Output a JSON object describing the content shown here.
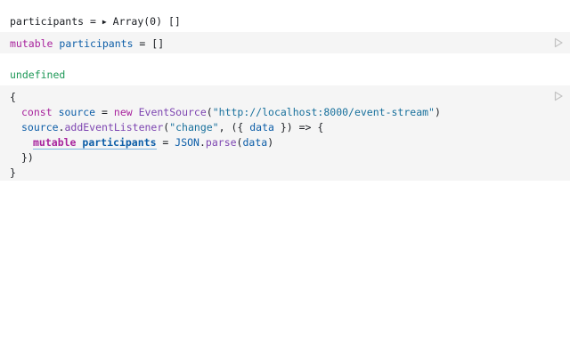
{
  "outputs": {
    "first": {
      "name": "participants",
      "eq": " = ",
      "toggle": "▶",
      "value": "Array(0)",
      "preview": " []"
    },
    "second": {
      "value": "undefined"
    }
  },
  "cell1": {
    "kw": "mutable",
    "name": "participants",
    "rest": " = []"
  },
  "cell2": {
    "l1": "{",
    "l2": {
      "kw_const": "const",
      "var_source": "source",
      "eq": " = ",
      "kw_new": "new",
      "cls": "EventSource",
      "open": "(",
      "url": "\"http://localhost:8000/event-stream\"",
      "close": ")"
    },
    "l3": {
      "obj": "source",
      "dot": ".",
      "method": "addEventListener",
      "open": "(",
      "event": "\"change\"",
      "mid": ", ({ ",
      "param": "data",
      "end": " }) => {"
    },
    "l4": {
      "kw": "mutable",
      "name": "participants",
      "eq": " = ",
      "json": "JSON",
      "dot": ".",
      "parse": "parse",
      "open": "(",
      "arg": "data",
      "close": ")"
    },
    "l5": "})",
    "l6": "}"
  },
  "colors": {
    "keyword": "#a8239d",
    "variable": "#0d5ea8",
    "string": "#18709c",
    "function": "#7d45b1",
    "undefined": "#1d9857",
    "cell_bg": "#f5f5f5",
    "run_icon": "#c4c4c4"
  },
  "icons": {
    "run": "play-outline-icon",
    "toggle": "disclosure-triangle-icon"
  }
}
